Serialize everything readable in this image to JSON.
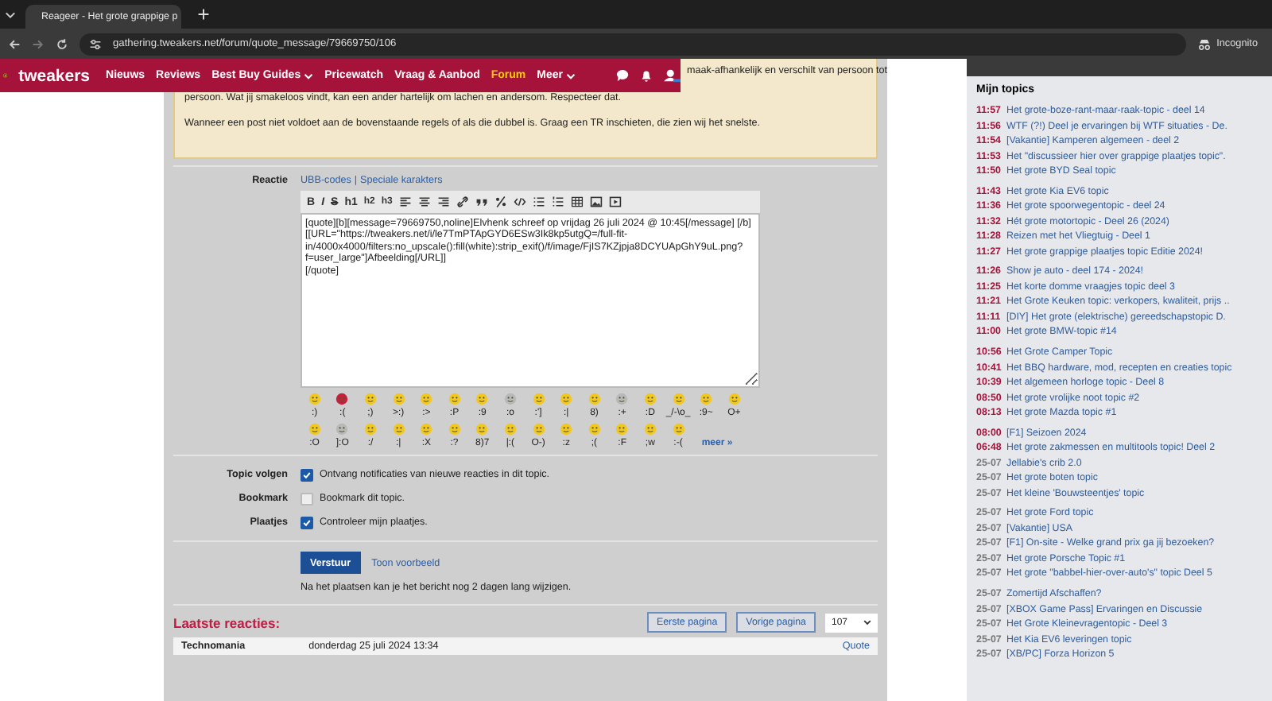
{
  "browser": {
    "tab_title": "Reageer - Het grote grappige p",
    "address": "gathering.tweakers.net/forum/quote_message/79669750/106",
    "profile_label": "Incognito"
  },
  "nav": {
    "brand": "tweakers",
    "items": [
      {
        "label": "Nieuws",
        "selected": false,
        "has_menu": false
      },
      {
        "label": "Reviews",
        "selected": false,
        "has_menu": false
      },
      {
        "label": "Best Buy Guides",
        "selected": false,
        "has_menu": true
      },
      {
        "label": "Pricewatch",
        "selected": false,
        "has_menu": false
      },
      {
        "label": "Vraag & Aanbod",
        "selected": false,
        "has_menu": false
      },
      {
        "label": "Forum",
        "selected": true,
        "has_menu": false
      },
      {
        "label": "Meer",
        "selected": false,
        "has_menu": true
      }
    ]
  },
  "notice": {
    "covered_line": "maak-afhankelijk en verschilt van persoon tot",
    "paragraphs": [
      "persoon. Wat jij smakeloos vindt, kan een ander hartelijk om lachen en andersom. Respecteer dat.",
      "Wanneer een post niet voldoet aan de bovenstaande regels of als die dubbel is. Graag een TR inschieten, die zien wij het snelste."
    ]
  },
  "reply": {
    "label": "Reactie",
    "links": [
      "UBB-codes",
      "Speciale karakters"
    ],
    "links_separator": "|",
    "toolbar_text": [
      "B",
      "I",
      "S",
      "h1",
      "h2",
      "h3"
    ],
    "text": "[quote][b][message=79669750,noline]Elvhenk schreef op vrijdag 26 juli 2024 @ 10:45[/message] [/b]\n[[URL=\"https://tweakers.net/i/le7TmPTApGYD6ESw3Ik8kp5utgQ=/full-fit-in/4000x4000/filters:no_upscale():fill(white):strip_exif()/f/image/FjIS7KZjpja8DCYUApGhY9uL.png?f=user_large\"]Afbeelding[/URL]]\n[/quote]",
    "smileys": [
      [
        {
          "code": ":)",
          "color": "#f2c81e"
        },
        {
          "code": ":(",
          "color": "#c8203c"
        },
        {
          "code": ";)",
          "color": "#f2c81e"
        },
        {
          "code": ">:)",
          "color": "#f2c81e"
        },
        {
          "code": ":>",
          "color": "#f2c81e"
        },
        {
          "code": ":P",
          "color": "#f2c81e"
        },
        {
          "code": ":9",
          "color": "#f2c81e"
        },
        {
          "code": ":o",
          "color": "#b8b8b8"
        },
        {
          "code": ":']",
          "color": "#f2c81e"
        },
        {
          "code": ":|",
          "color": "#f2c81e"
        },
        {
          "code": "8)",
          "color": "#f2c81e"
        },
        {
          "code": ":+",
          "color": "#b8b8b8"
        },
        {
          "code": ":D",
          "color": "#f2c81e"
        },
        {
          "code": "_/-\\o_",
          "color": "#f2c81e"
        },
        {
          "code": ":9~",
          "color": "#f2c81e"
        },
        {
          "code": "O+",
          "color": "#f2c81e"
        }
      ],
      [
        {
          "code": ":O",
          "color": "#f2c81e"
        },
        {
          "code": "]:O",
          "color": "#b8b8b8"
        },
        {
          "code": ":/",
          "color": "#f2c81e"
        },
        {
          "code": ":|",
          "color": "#f2c81e"
        },
        {
          "code": ":X",
          "color": "#f2c81e"
        },
        {
          "code": ":?",
          "color": "#f2c81e"
        },
        {
          "code": "8)7",
          "color": "#f2c81e"
        },
        {
          "code": "|:(",
          "color": "#f2c81e"
        },
        {
          "code": "O-)",
          "color": "#f2c81e"
        },
        {
          "code": ":z",
          "color": "#f2c81e"
        },
        {
          "code": ";(",
          "color": "#f2c81e"
        },
        {
          "code": ":F",
          "color": "#f2c81e"
        },
        {
          "code": ";w",
          "color": "#f2c81e"
        },
        {
          "code": ":-(",
          "color": "#f2c81e"
        }
      ]
    ],
    "more_link": "meer »"
  },
  "options": [
    {
      "label": "Topic volgen",
      "text": "Ontvang notificaties van nieuwe reacties in dit topic.",
      "checked": true
    },
    {
      "label": "Bookmark",
      "text": "Bookmark dit topic.",
      "checked": false
    },
    {
      "label": "Plaatjes",
      "text": "Controleer mijn plaatjes.",
      "checked": true
    }
  ],
  "submit": {
    "button": "Verstuur",
    "preview_link": "Toon voorbeeld",
    "note": "Na het plaatsen kan je het bericht nog 2 dagen lang wijzigen."
  },
  "latest": {
    "title": "Laatste reacties:",
    "buttons": [
      "Eerste pagina",
      "Vorige pagina"
    ],
    "page_select": "107",
    "post": {
      "author": "Technomania",
      "date": "donderdag 25 juli 2024 13:34",
      "action": "Quote"
    }
  },
  "sidebar": {
    "title": "Mijn topics",
    "groups": [
      [
        {
          "time": "11:57",
          "title": "Het grote-boze-rant-maar-raak-topic - deel 14",
          "color": "#a5123a"
        },
        {
          "time": "11:56",
          "title": "WTF (?!) Deel je ervaringen bij WTF situaties - De.",
          "color": "#a5123a"
        },
        {
          "time": "11:54",
          "title": "[Vakantie] Kamperen algemeen - deel 2",
          "color": "#a5123a"
        },
        {
          "time": "11:53",
          "title": "Het \"discussieer hier over grappige plaatjes topic\".",
          "color": "#a5123a"
        },
        {
          "time": "11:50",
          "title": "Het grote BYD Seal topic",
          "color": "#a5123a"
        }
      ],
      [
        {
          "time": "11:43",
          "title": "Het grote Kia EV6 topic",
          "color": "#a5123a"
        },
        {
          "time": "11:36",
          "title": "Het grote spoorwegentopic - deel 24",
          "color": "#a5123a"
        },
        {
          "time": "11:32",
          "title": "Hét grote motortopic - Deel 26 (2024)",
          "color": "#a5123a"
        },
        {
          "time": "11:28",
          "title": "Reizen met het Vliegtuig - Deel 1",
          "color": "#a5123a"
        },
        {
          "time": "11:27",
          "title": "Het grote grappige plaatjes topic Editie 2024!",
          "color": "#a5123a"
        }
      ],
      [
        {
          "time": "11:26",
          "title": "Show je auto - deel 174 - 2024!",
          "color": "#a5123a"
        },
        {
          "time": "11:25",
          "title": "Het korte domme vraagjes topic deel 3",
          "color": "#a5123a"
        },
        {
          "time": "11:21",
          "title": "Het Grote Keuken topic: verkopers, kwaliteit, prijs ..",
          "color": "#a5123a"
        },
        {
          "time": "11:11",
          "title": "[DIY] Het grote (elektrische) gereedschapstopic D.",
          "color": "#a5123a"
        },
        {
          "time": "11:00",
          "title": "Het grote BMW-topic #14",
          "color": "#a5123a"
        }
      ],
      [
        {
          "time": "10:56",
          "title": "Het Grote Camper Topic",
          "color": "#a5123a"
        },
        {
          "time": "10:41",
          "title": "Het BBQ hardware, mod, recepten en creaties topic",
          "color": "#a5123a"
        },
        {
          "time": "10:39",
          "title": "Het algemeen horloge topic - Deel 8",
          "color": "#a5123a"
        },
        {
          "time": "08:50",
          "title": "Het grote vrolijke noot topic #2",
          "color": "#a5123a"
        },
        {
          "time": "08:13",
          "title": "Het grote Mazda topic #1",
          "color": "#a5123a"
        }
      ],
      [
        {
          "time": "08:00",
          "title": "[F1] Seizoen 2024",
          "color": "#a5123a"
        },
        {
          "time": "06:48",
          "title": "Het grote zakmessen en multitools topic! Deel 2",
          "color": "#a5123a"
        },
        {
          "time": "25-07",
          "title": "Jellabie's crib 2.0",
          "color": "#777777"
        },
        {
          "time": "25-07",
          "title": "Het grote boten topic",
          "color": "#777777"
        },
        {
          "time": "25-07",
          "title": "Het kleine 'Bouwsteentjes' topic",
          "color": "#777777"
        }
      ],
      [
        {
          "time": "25-07",
          "title": "Het grote Ford topic",
          "color": "#777777"
        },
        {
          "time": "25-07",
          "title": "[Vakantie] USA",
          "color": "#777777"
        },
        {
          "time": "25-07",
          "title": "[F1] On-site - Welke grand prix ga jij bezoeken?",
          "color": "#777777"
        },
        {
          "time": "25-07",
          "title": "Het grote Porsche Topic #1",
          "color": "#777777"
        },
        {
          "time": "25-07",
          "title": "Het grote \"babbel-hier-over-auto's\" topic Deel 5",
          "color": "#777777"
        }
      ],
      [
        {
          "time": "25-07",
          "title": "Zomertijd Afschaffen?",
          "color": "#777777"
        },
        {
          "time": "25-07",
          "title": "[XBOX Game Pass] Ervaringen en Discussie",
          "color": "#777777"
        },
        {
          "time": "25-07",
          "title": "Het Grote Kleinevragentopic - Deel 3",
          "color": "#777777"
        },
        {
          "time": "25-07",
          "title": "Het Kia EV6 leveringen topic",
          "color": "#777777"
        },
        {
          "time": "25-07",
          "title": "[XB/PC] Forza Horizon 5",
          "color": "#777777"
        }
      ]
    ]
  }
}
